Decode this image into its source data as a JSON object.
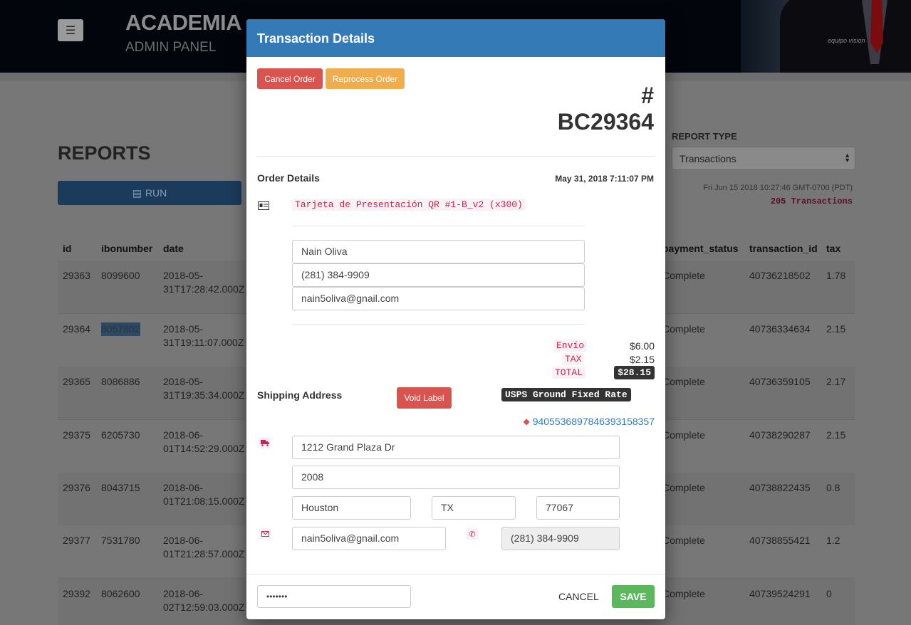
{
  "header": {
    "title": "ACADEMIA",
    "subtitle": "ADMIN PANEL",
    "photo_logo": "equipo vision"
  },
  "reports": {
    "title": "REPORTS",
    "run_label": "RUN",
    "report_type_label": "REPORT TYPE",
    "report_type_value": "Transactions",
    "generated_at": "Fri Jun 15 2018 10:27:46 GMT-0700 (PDT)",
    "transactions_count": "205 Transactions",
    "columns_left": [
      "id",
      "ibonumber",
      "date"
    ],
    "columns_right": [
      "payment_status",
      "transaction_id",
      "tax"
    ],
    "rows": [
      {
        "id": "29363",
        "ibonumber": "8099600",
        "date": "2018-05-31T17:28:42.000Z",
        "payment_status": "Complete",
        "transaction_id": "40736218502",
        "tax": "1.78"
      },
      {
        "id": "29364",
        "ibonumber": "8057802",
        "date": "2018-05-31T19:11:07.000Z",
        "payment_status": "Complete",
        "transaction_id": "40736334634",
        "tax": "2.15"
      },
      {
        "id": "29365",
        "ibonumber": "8086886",
        "date": "2018-05-31T19:35:34.000Z",
        "payment_status": "Complete",
        "transaction_id": "40736359105",
        "tax": "2.17"
      },
      {
        "id": "29375",
        "ibonumber": "6205730",
        "date": "2018-06-01T14:52:29.000Z",
        "payment_status": "Complete",
        "transaction_id": "40738290287",
        "tax": "2.15"
      },
      {
        "id": "29376",
        "ibonumber": "8043715",
        "date": "2018-06-01T21:08:15.000Z",
        "payment_status": "Complete",
        "transaction_id": "40738822435",
        "tax": "0.8"
      },
      {
        "id": "29377",
        "ibonumber": "7531780",
        "date": "2018-06-01T21:28:57.000Z",
        "payment_status": "Complete",
        "transaction_id": "40738855421",
        "tax": "1.2"
      },
      {
        "id": "29392",
        "ibonumber": "8062600",
        "date": "2018-06-02T12:59:03.000Z",
        "payment_status": "Complete",
        "transaction_id": "40739524291",
        "tax": "0"
      }
    ]
  },
  "modal": {
    "title": "Transaction Details",
    "cancel_order_label": "Cancel Order",
    "reprocess_order_label": "Reprocess Order",
    "order_hash": "#",
    "order_number": "BC29364",
    "order_details_title": "Order Details",
    "order_date": "May 31, 2018 7:11:07 PM",
    "product_line": "Tarjeta de Presentación QR #1-B_v2 (x300)",
    "customer": {
      "name": "Nain Oliva",
      "phone": "(281) 384-9909",
      "email": "nain5oliva@gnail.com"
    },
    "totals": {
      "shipping_label": "Envío",
      "shipping_value": "$6.00",
      "tax_label": "TAX",
      "tax_value": "$2.15",
      "total_label": "TOTAL",
      "total_value": "$28.15"
    },
    "shipping_title": "Shipping Address",
    "void_label": "Void Label",
    "shipping_method": "USPS Ground Fixed Rate",
    "tracking_number": "9405536897846393158357",
    "address": {
      "street": "1212 Grand Plaza Dr",
      "line2": "2008",
      "city": "Houston",
      "state": "TX",
      "zip": "77067",
      "email": "nain5oliva@gnail.com",
      "phone": "(281) 384-9909"
    },
    "password_mask": "•••••••",
    "cancel_label": "CANCEL",
    "save_label": "SAVE"
  },
  "colors": {
    "modal_header": "#337ab7",
    "danger": "#d9534f",
    "warning": "#f0ad4e",
    "success": "#5cb85c",
    "code_red": "#c7254e"
  }
}
